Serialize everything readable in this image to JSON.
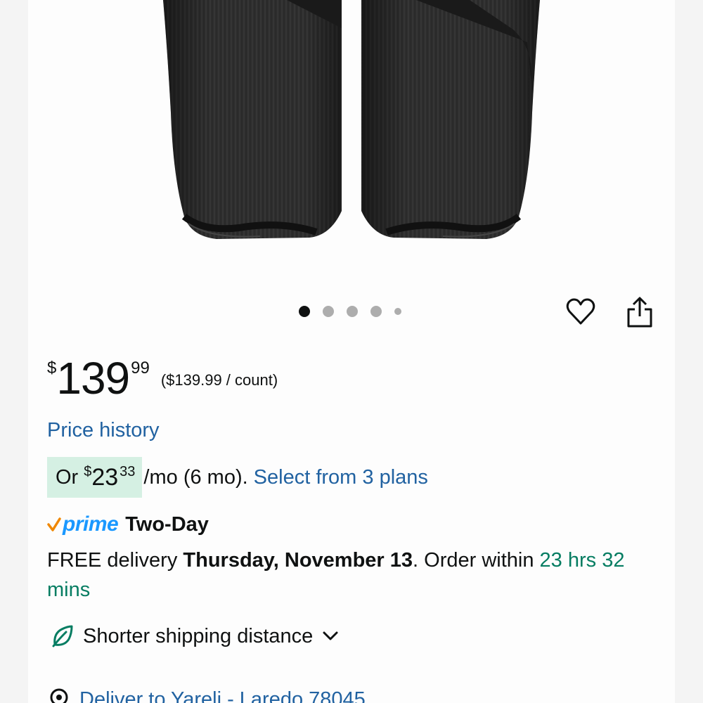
{
  "product": {
    "image_alt": "leg compression sleeves",
    "carousel": {
      "total_dots": 5,
      "active_index": 0
    },
    "actions": {
      "favorite_icon": "heart-icon",
      "share_icon": "share-icon"
    }
  },
  "price": {
    "symbol": "$",
    "whole": "139",
    "fraction": "99",
    "unit_price": "($139.99 / count)"
  },
  "price_history_link": "Price history",
  "installment": {
    "or": "Or",
    "symbol": "$",
    "whole": "23",
    "fraction": "33",
    "rest": "/mo (6 mo).",
    "plans_link": "Select from 3 plans"
  },
  "prime": {
    "word": "prime",
    "label": "Two-Day"
  },
  "delivery": {
    "prefix": "FREE delivery ",
    "date": "Thursday, November 13",
    "middle": ". Order within ",
    "countdown": "23 hrs 32 mins"
  },
  "shipping": {
    "label": "Shorter shipping distance",
    "icon": "leaf-icon"
  },
  "deliver_to": {
    "label": "Deliver to Yareli - Laredo 78045",
    "icon": "location-pin-icon"
  },
  "colors": {
    "link": "#2162a1",
    "teal": "#067d62",
    "prime": "#1a98ff",
    "badge_bg": "#d5f0e3"
  }
}
